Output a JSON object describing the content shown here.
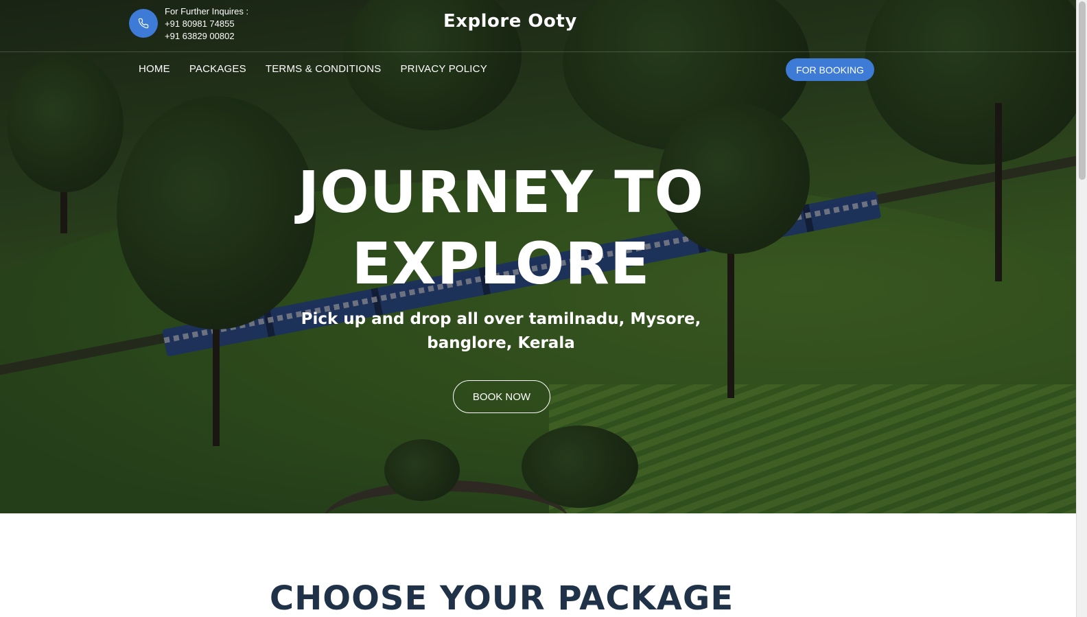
{
  "header": {
    "contact_label": "For Further Inquires :",
    "phone_1": "+91 80981 74855",
    "phone_2": "+91 63829 00802",
    "brand": "Explore Ooty"
  },
  "nav": {
    "items": [
      {
        "label": "HOME"
      },
      {
        "label": "PACKAGES"
      },
      {
        "label": "TERMS & CONDITIONS"
      },
      {
        "label": "PRIVACY POLICY"
      }
    ],
    "booking_button": "FOR BOOKING"
  },
  "hero": {
    "headline_line1": "JOURNEY TO",
    "headline_line2": "EXPLORE",
    "subline": "Pick up and drop all over tamilnadu, Mysore, banglore, Kerala",
    "cta": "BOOK NOW"
  },
  "packages": {
    "title": "CHOOSE YOUR PACKAGE"
  },
  "colors": {
    "accent": "#3d7bd6",
    "heading_dark": "#1f3248"
  }
}
